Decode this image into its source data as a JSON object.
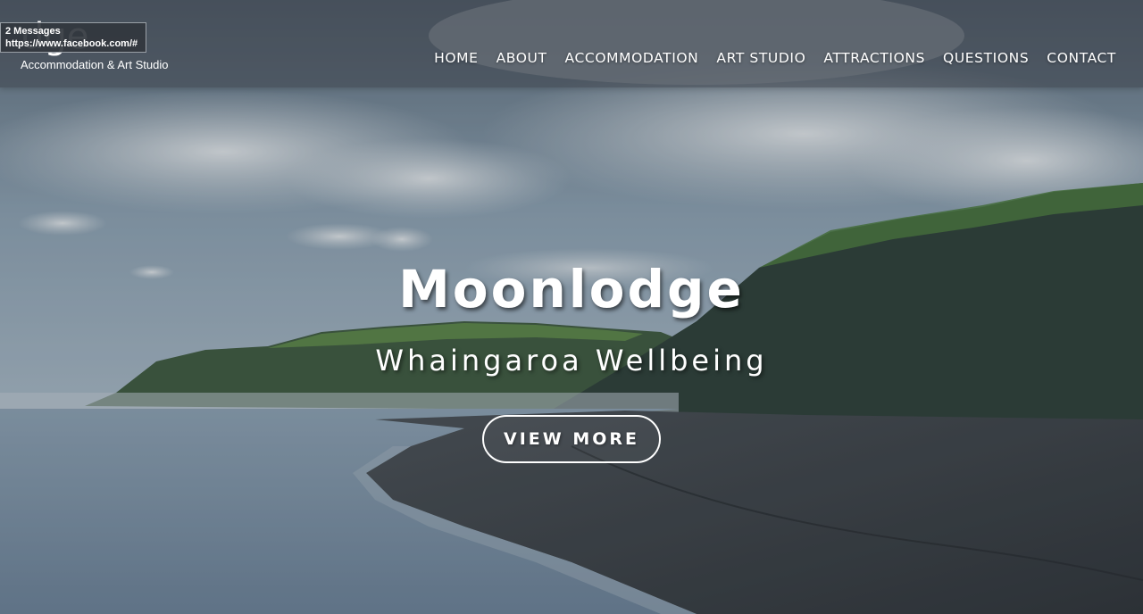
{
  "site": {
    "logo_text": "dge",
    "tagline": "Accommodation & Art Studio"
  },
  "tooltip": {
    "line1": "2 Messages",
    "line2": "https://www.facebook.com/#"
  },
  "nav": {
    "items": [
      {
        "label": "HOME"
      },
      {
        "label": "ABOUT"
      },
      {
        "label": "ACCOMMODATION"
      },
      {
        "label": "ART STUDIO"
      },
      {
        "label": "ATTRACTIONS"
      },
      {
        "label": "QUESTIONS"
      },
      {
        "label": "CONTACT"
      }
    ]
  },
  "hero": {
    "title": "Moonlodge",
    "subtitle": "Whaingaroa Wellbeing",
    "cta_label": "VIEW MORE"
  },
  "colors": {
    "header_bg": "#3c424a",
    "text": "#ffffff",
    "sky": "#8ea3b5",
    "hill": "#2f3e36",
    "sand": "#3a3f44",
    "water": "#7a90a6"
  }
}
